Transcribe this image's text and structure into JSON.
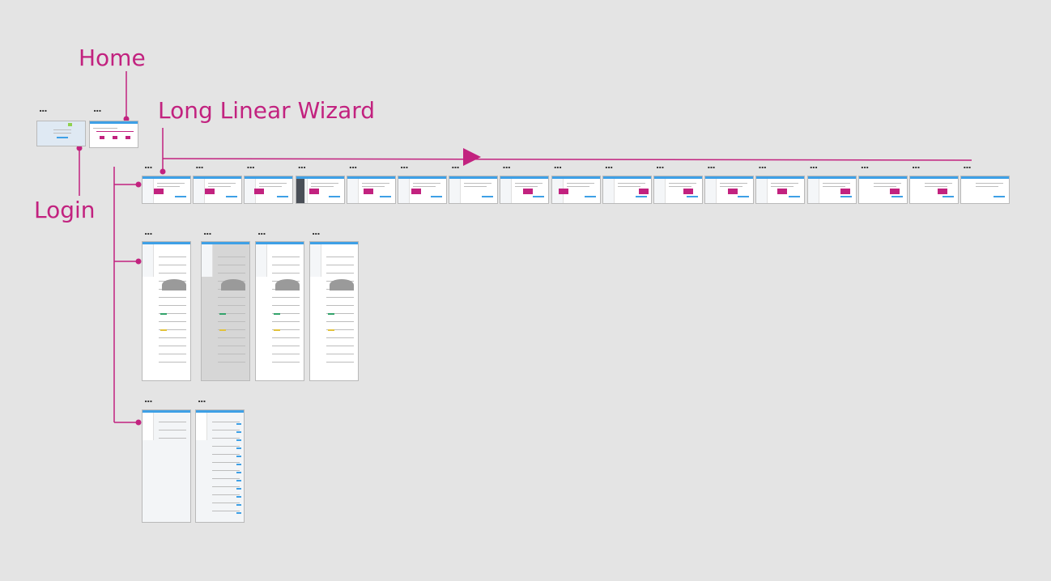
{
  "labels": {
    "home": "Home",
    "wizard": "Long Linear Wizard",
    "login": "Login"
  },
  "more_glyph": "...",
  "colors": {
    "accent": "#c2227f",
    "background": "#e4e4e4",
    "thumb_header": "#3ea0e6"
  },
  "groups": {
    "entry_screens": {
      "count": 2,
      "names": [
        "Login",
        "Home"
      ]
    },
    "wizard_screens": {
      "count": 17
    },
    "detail_screens": {
      "count": 4
    },
    "list_screens": {
      "count": 2
    }
  }
}
